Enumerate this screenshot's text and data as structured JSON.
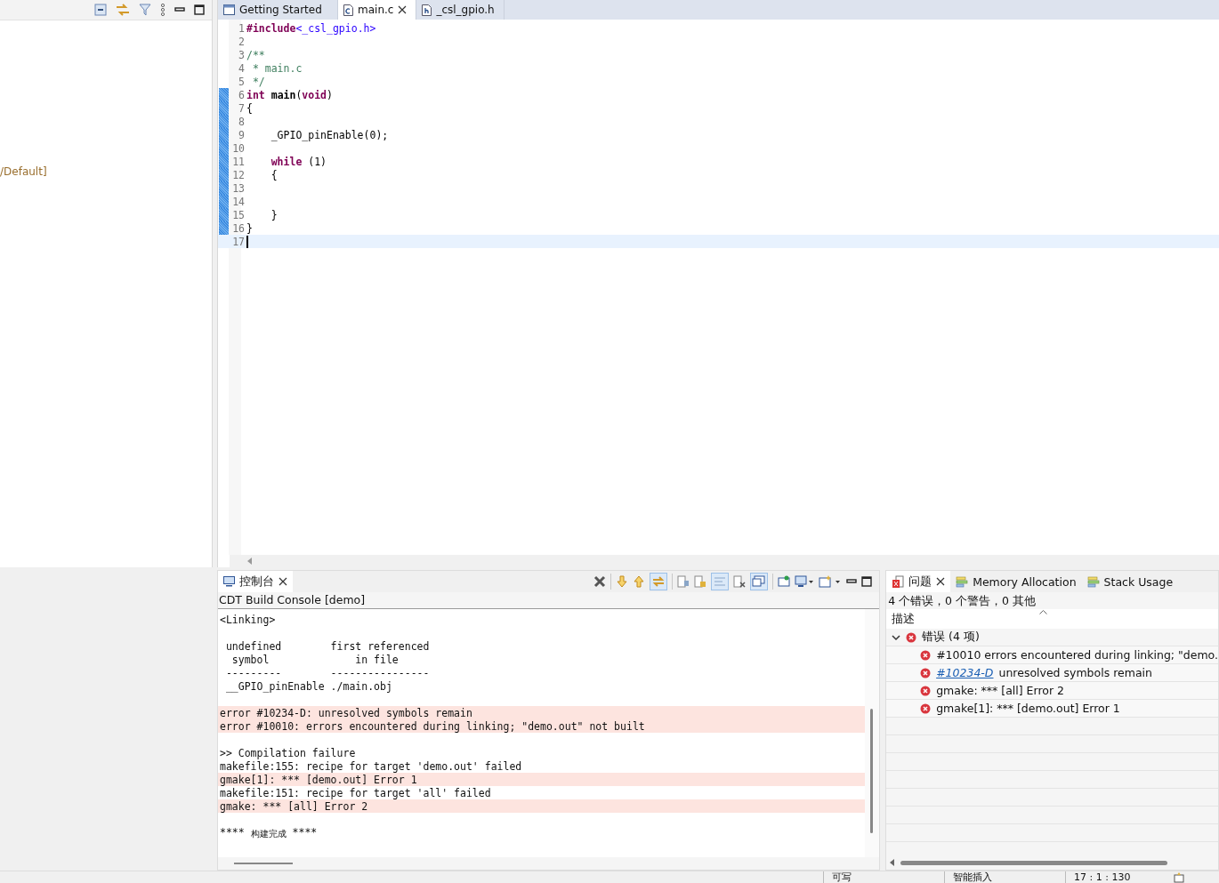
{
  "left_panel": {
    "fragment": "/Default]"
  },
  "editor_tabs": [
    {
      "label": "Getting Started",
      "kind": "welcome",
      "selected": false,
      "closable": false
    },
    {
      "label": "main.c",
      "kind": "c",
      "selected": true,
      "closable": true
    },
    {
      "label": "_csl_gpio.h",
      "kind": "h",
      "selected": false,
      "closable": false
    }
  ],
  "code_lines": [
    {
      "number": "1",
      "changed": false,
      "current": false,
      "tokens": [
        {
          "kind": "directive",
          "text": "#include"
        },
        {
          "kind": "header",
          "text": "<_csl_gpio.h>"
        }
      ]
    },
    {
      "number": "2",
      "changed": false,
      "current": false
    },
    {
      "number": "3",
      "changed": false,
      "current": false,
      "tokens": [
        {
          "kind": "comment",
          "text": "/**"
        }
      ]
    },
    {
      "number": "4",
      "changed": false,
      "current": false,
      "tokens": [
        {
          "kind": "comment",
          "text": " * main.c"
        }
      ]
    },
    {
      "number": "5",
      "changed": false,
      "current": false,
      "tokens": [
        {
          "kind": "comment",
          "text": " */"
        }
      ]
    },
    {
      "number": "6",
      "changed": true,
      "current": false,
      "tokens": [
        {
          "kind": "keyword",
          "text": "int"
        },
        {
          "kind": "function",
          "text": " main"
        },
        {
          "kind": "plain",
          "text": "("
        },
        {
          "kind": "keyword",
          "text": "void"
        },
        {
          "kind": "plain",
          "text": ")"
        }
      ]
    },
    {
      "number": "7",
      "changed": true,
      "current": false,
      "tokens": [
        {
          "kind": "plain",
          "text": "{"
        }
      ]
    },
    {
      "number": "8",
      "changed": true,
      "current": false
    },
    {
      "number": "9",
      "changed": true,
      "current": false,
      "tokens": [
        {
          "kind": "plain",
          "text": "    _GPIO_pinEnable(0);"
        }
      ]
    },
    {
      "number": "10",
      "changed": true,
      "current": false
    },
    {
      "number": "11",
      "changed": true,
      "current": false,
      "tokens": [
        {
          "kind": "keyword",
          "text": "    while"
        },
        {
          "kind": "plain",
          "text": " (1)"
        }
      ]
    },
    {
      "number": "12",
      "changed": true,
      "current": false,
      "tokens": [
        {
          "kind": "plain",
          "text": "    {"
        }
      ]
    },
    {
      "number": "13",
      "changed": true,
      "current": false
    },
    {
      "number": "14",
      "changed": true,
      "current": false
    },
    {
      "number": "15",
      "changed": true,
      "current": false,
      "tokens": [
        {
          "kind": "plain",
          "text": "    }"
        }
      ]
    },
    {
      "number": "16",
      "changed": true,
      "current": false,
      "tokens": [
        {
          "kind": "plain",
          "text": "}"
        }
      ]
    },
    {
      "number": "17",
      "changed": false,
      "current": true
    }
  ],
  "console": {
    "tab": {
      "label": "控制台",
      "selected": true
    },
    "title": "CDT Build Console [demo]",
    "lines": [
      {
        "text": "<Linking>",
        "kind": "normal"
      },
      {
        "kind": "normal"
      },
      {
        "text": " undefined        first referenced",
        "kind": "normal"
      },
      {
        "text": "  symbol              in file",
        "kind": "normal"
      },
      {
        "text": " ---------        ----------------",
        "kind": "normal"
      },
      {
        "text": " __GPIO_pinEnable ./main.obj",
        "kind": "normal"
      },
      {
        "kind": "normal"
      },
      {
        "text": "error #10234-D: unresolved symbols remain",
        "kind": "error"
      },
      {
        "text": "error #10010: errors encountered during linking; \"demo.out\" not built",
        "kind": "error"
      },
      {
        "kind": "normal"
      },
      {
        "text": ">> Compilation failure",
        "kind": "normal"
      },
      {
        "text": "makefile:155: recipe for target 'demo.out' failed",
        "kind": "normal"
      },
      {
        "text": "gmake[1]: *** [demo.out] Error 1",
        "kind": "error"
      },
      {
        "text": "makefile:151: recipe for target 'all' failed",
        "kind": "normal"
      },
      {
        "text": "gmake: *** [all] Error 2",
        "kind": "error"
      },
      {
        "kind": "normal"
      },
      {
        "text": "****",
        "small": "构建完成",
        "suffix": "****",
        "kind": "normal"
      }
    ]
  },
  "problems": {
    "tabs": [
      {
        "label": "问题",
        "kind": "problems",
        "selected": true,
        "closable": true
      },
      {
        "label": "Memory Allocation",
        "kind": "memory",
        "selected": false,
        "closable": false
      },
      {
        "label": "Stack Usage",
        "kind": "memory",
        "selected": false,
        "closable": false
      }
    ],
    "summary": "4 个错误，0 个警告，0 其他",
    "column": "描述",
    "group": {
      "label": "错误 (4 项)",
      "expanded": true,
      "children": [
        {
          "text": "#10010 errors encountered during linking; \"demo."
        },
        {
          "link": "#10234-D",
          "text": "unresolved symbols remain"
        },
        {
          "text": "gmake: *** [all] Error 2"
        },
        {
          "text": "gmake[1]: *** [demo.out] Error 1"
        }
      ]
    }
  },
  "status_bar": [
    "可写",
    "智能插入",
    "17 : 1 : 130"
  ]
}
